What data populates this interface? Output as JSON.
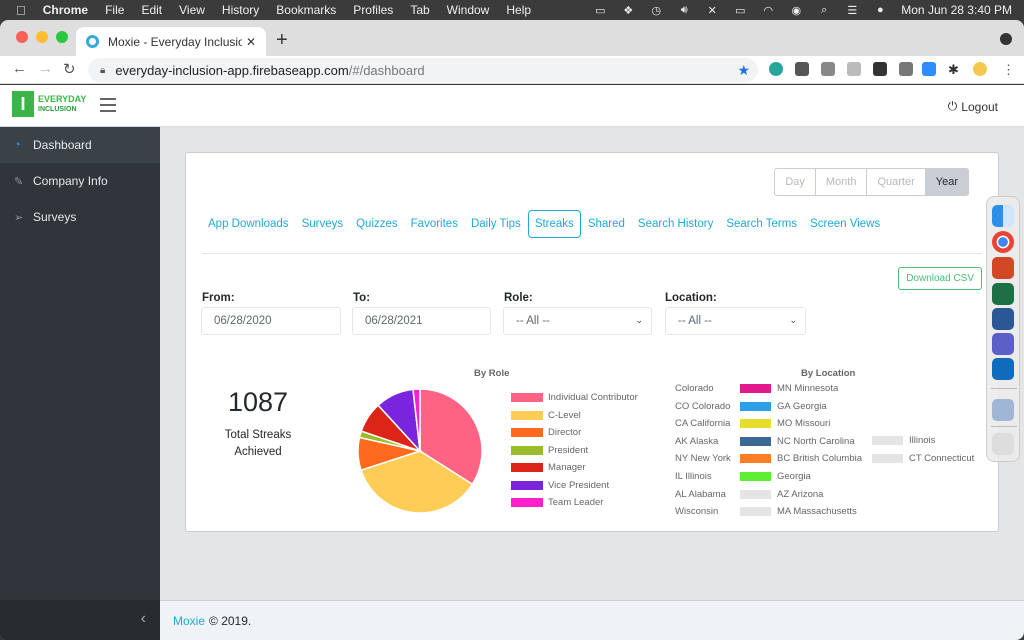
{
  "menubar": {
    "apple": "",
    "app_name": "Chrome",
    "items": [
      "File",
      "Edit",
      "View",
      "History",
      "Bookmarks",
      "Profiles",
      "Tab",
      "Window",
      "Help"
    ],
    "clock": "Mon Jun 28  3:40 PM"
  },
  "browser": {
    "tab_title": "Moxie - Everyday Inclusion App",
    "url_host": "everyday-inclusion-app.firebaseapp.com",
    "url_path": "/#/dashboard"
  },
  "header": {
    "logo_line1": "EVERYDAY",
    "logo_line2": "INCLUSION",
    "logout_label": "Logout"
  },
  "sidebar": {
    "items": [
      {
        "label": "Dashboard",
        "icon": "speedometer-icon",
        "active": true
      },
      {
        "label": "Company Info",
        "icon": "eyedropper-icon",
        "active": false
      },
      {
        "label": "Surveys",
        "icon": "paper-plane-icon",
        "active": false
      }
    ]
  },
  "period": {
    "options": [
      "Day",
      "Month",
      "Quarter",
      "Year"
    ],
    "selected": "Year"
  },
  "tabs": {
    "items": [
      "App Downloads",
      "Surveys",
      "Quizzes",
      "Favorites",
      "Daily Tips",
      "Streaks",
      "Shared",
      "Search History",
      "Search Terms",
      "Screen Views"
    ],
    "active": "Streaks"
  },
  "download_csv_label": "Download CSV",
  "filters": {
    "from_label": "From:",
    "from_value": "06/28/2020",
    "to_label": "To:",
    "to_value": "06/28/2021",
    "role_label": "Role:",
    "role_value": "-- All --",
    "location_label": "Location:",
    "location_value": "-- All --"
  },
  "stat": {
    "value": "1087",
    "label": "Total Streaks Achieved"
  },
  "chart_data": {
    "type": "pie",
    "title": "By Role",
    "legend_position": "right",
    "categories": [
      "Individual Contributor",
      "C-Level",
      "Director",
      "President",
      "Manager",
      "Vice President",
      "Team Leader"
    ],
    "values": [
      34,
      36,
      8.5,
      1.7,
      8,
      10,
      1.8
    ],
    "unit": "percent (estimated)",
    "colors": [
      "#ff6384",
      "#ffcd56",
      "#ff6a1f",
      "#9bbb2b",
      "#dd2418",
      "#7a24dd",
      "#ff1fcc"
    ]
  },
  "location_chart": {
    "title": "By Location",
    "col1": [
      "Colorado",
      "CO Colorado",
      "CA California",
      "AK Alaska",
      "NY New York",
      "IL Illinois",
      "AL Alabama",
      "Wisconsin"
    ],
    "col2": [
      {
        "label": "MN Minnesota",
        "color": "#e0198c"
      },
      {
        "label": "GA Georgia",
        "color": "#2d9ee8"
      },
      {
        "label": "MO Missouri",
        "color": "#e6dc2c"
      },
      {
        "label": "NC North Carolina",
        "color": "#3b6894"
      },
      {
        "label": "BC British Columbia",
        "color": "#ff7d26"
      },
      {
        "label": "Georgia",
        "color": "#5cef33"
      },
      {
        "label": "AZ Arizona",
        "color": "#e4e4e4"
      },
      {
        "label": "MA Massachusetts",
        "color": "#e4e4e4"
      }
    ],
    "col3": [
      {
        "label": "Illinois",
        "color": "#e4e4e4"
      },
      {
        "label": "CT Connecticut",
        "color": "#e4e4e4"
      }
    ]
  },
  "footer": {
    "brand": "Moxie",
    "text": "© 2019."
  }
}
